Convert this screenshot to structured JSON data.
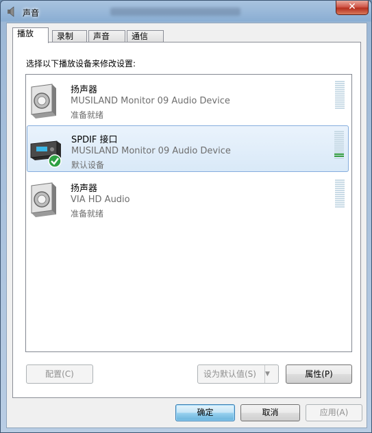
{
  "window": {
    "title": "声音",
    "close_label": "✕"
  },
  "tabs": [
    {
      "label": "播放",
      "active": true
    },
    {
      "label": "录制",
      "active": false
    },
    {
      "label": "声音",
      "active": false
    },
    {
      "label": "通信",
      "active": false
    }
  ],
  "instruction": "选择以下播放设备来修改设置:",
  "devices": [
    {
      "name": "扬声器",
      "description": "MUSILAND Monitor 09 Audio Device",
      "status": "准备就绪",
      "icon": "speaker-icon",
      "selected": false,
      "meter_level": 0
    },
    {
      "name": "SPDIF 接口",
      "description": "MUSILAND Monitor 09 Audio Device",
      "status": "默认设备",
      "icon": "spdif-device-icon",
      "badge": "default-checkmark-icon",
      "selected": true,
      "meter_level": 0.1
    },
    {
      "name": "扬声器",
      "description": "VIA HD Audio",
      "status": "准备就绪",
      "icon": "speaker-icon",
      "selected": false,
      "meter_level": 0
    }
  ],
  "buttons": {
    "configure": "配置(C)",
    "set_default": "设为默认值(S)",
    "properties": "属性(P)",
    "ok": "确定",
    "cancel": "取消",
    "apply": "应用(A)"
  },
  "colors": {
    "selection_bg": "#d9e9f8",
    "meter_active": "#2e9a3a",
    "meter_idle": "#c9dbe6"
  }
}
